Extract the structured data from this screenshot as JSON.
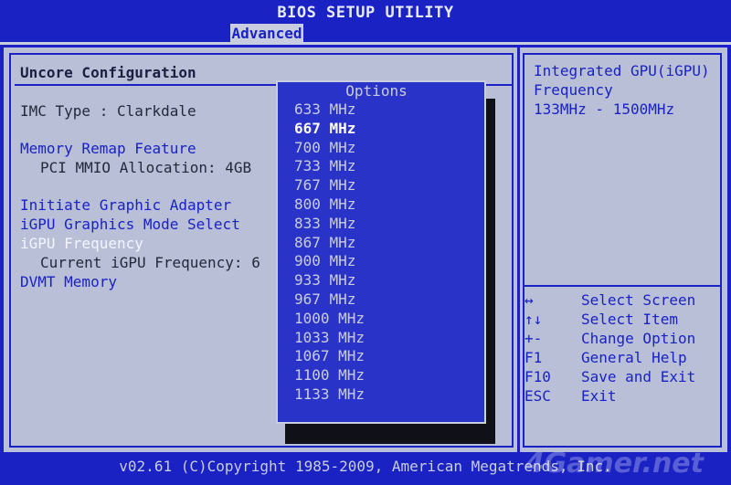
{
  "app": {
    "title": "BIOS SETUP UTILITY",
    "active_tab": "Advanced"
  },
  "left": {
    "section_title": "Uncore Configuration",
    "items": [
      {
        "label": "IMC Type : Clarkdale",
        "style": "dark"
      },
      {
        "label": "Memory Remap Feature",
        "style": "blue"
      },
      {
        "label": "PCI MMIO Allocation: 4GB",
        "style": "dark"
      },
      {
        "label": "Initiate Graphic Adapter",
        "style": "blue"
      },
      {
        "label": "iGPU Graphics Mode Select",
        "style": "blue"
      },
      {
        "label": "iGPU Frequency",
        "style": "white"
      },
      {
        "label": "Current iGPU Frequency: 6",
        "style": "dark"
      },
      {
        "label": "DVMT Memory",
        "style": "blue"
      }
    ]
  },
  "options": {
    "title": "Options",
    "items": [
      "633 MHz",
      "667 MHz",
      "700 MHz",
      "733 MHz",
      "767 MHz",
      "800 MHz",
      "833 MHz",
      "867 MHz",
      "900 MHz",
      "933 MHz",
      "967 MHz",
      "1000 MHz",
      "1033 MHz",
      "1067 MHz",
      "1100 MHz",
      "1133 MHz"
    ],
    "selected": "667 MHz"
  },
  "help": {
    "line1": "Integrated GPU(iGPU)",
    "line2": "Frequency",
    "line3": "133MHz - 1500MHz",
    "keys": [
      {
        "key": "↔",
        "action": "Select Screen"
      },
      {
        "key": "↑↓",
        "action": "Select Item"
      },
      {
        "key": "+-",
        "action": "Change Option"
      },
      {
        "key": "F1",
        "action": "General Help"
      },
      {
        "key": "F10",
        "action": "Save and Exit"
      },
      {
        "key": "ESC",
        "action": "Exit"
      }
    ]
  },
  "status": "v02.61 (C)Copyright 1985-2009, American Megatrends, Inc.",
  "watermark": "4Gamer.net"
}
